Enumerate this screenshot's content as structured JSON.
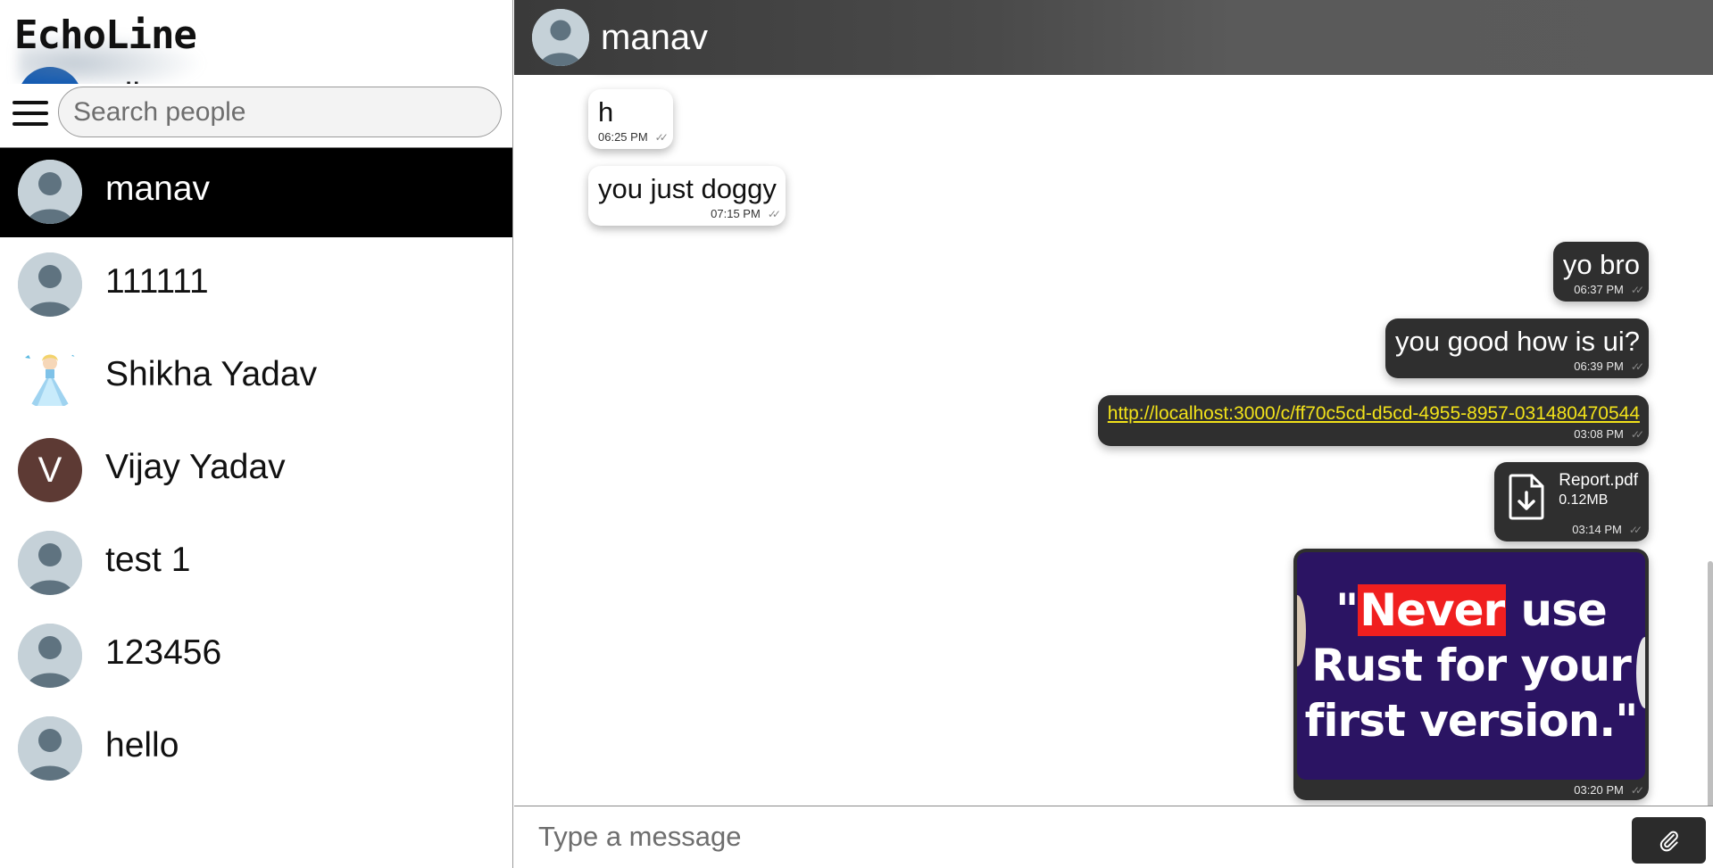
{
  "app": {
    "brand": "EchoLine"
  },
  "search": {
    "placeholder": "Search people"
  },
  "contacts": [
    {
      "name": "elite",
      "avatar_type": "letter",
      "initial": "e",
      "color": "#0b57b5"
    },
    {
      "name": "manav",
      "avatar_type": "default",
      "active": true
    },
    {
      "name": "111111",
      "avatar_type": "default"
    },
    {
      "name": "Shikha Yadav",
      "avatar_type": "photo",
      "icon": "princess-avatar-icon"
    },
    {
      "name": "Vijay Yadav",
      "avatar_type": "letter",
      "initial": "V",
      "color": "#5d3a34"
    },
    {
      "name": "test 1",
      "avatar_type": "default"
    },
    {
      "name": "123456",
      "avatar_type": "default"
    },
    {
      "name": "hello",
      "avatar_type": "default"
    }
  ],
  "chat": {
    "header_name": "manav",
    "messages": [
      {
        "direction": "in",
        "text": "h",
        "time": "06:25 PM"
      },
      {
        "direction": "in",
        "text": "you just doggy",
        "time": "07:15 PM"
      },
      {
        "direction": "out",
        "text": "yo bro",
        "time": "06:37 PM"
      },
      {
        "direction": "out",
        "text": "you good how is ui?",
        "time": "06:39 PM"
      },
      {
        "direction": "out",
        "type": "link",
        "text": "http://localhost:3000/c/ff70c5cd-d5cd-4955-8957-031480470544",
        "time": "03:08 PM"
      },
      {
        "direction": "out",
        "type": "file",
        "file_name": "Report.pdf",
        "file_size": "0.12MB",
        "time": "03:14 PM"
      },
      {
        "direction": "out",
        "type": "image",
        "image_text_pre": "\"",
        "image_text_highlight": "Never",
        "image_text_post": " use Rust for your first version.\"",
        "time": "03:20 PM"
      }
    ]
  },
  "composer": {
    "placeholder": "Type a message"
  },
  "colors": {
    "active_contact_bg": "#000000",
    "outgoing_bubble": "#2f2f2f",
    "link": "#f2e21a",
    "header": "#5b5b5b"
  }
}
